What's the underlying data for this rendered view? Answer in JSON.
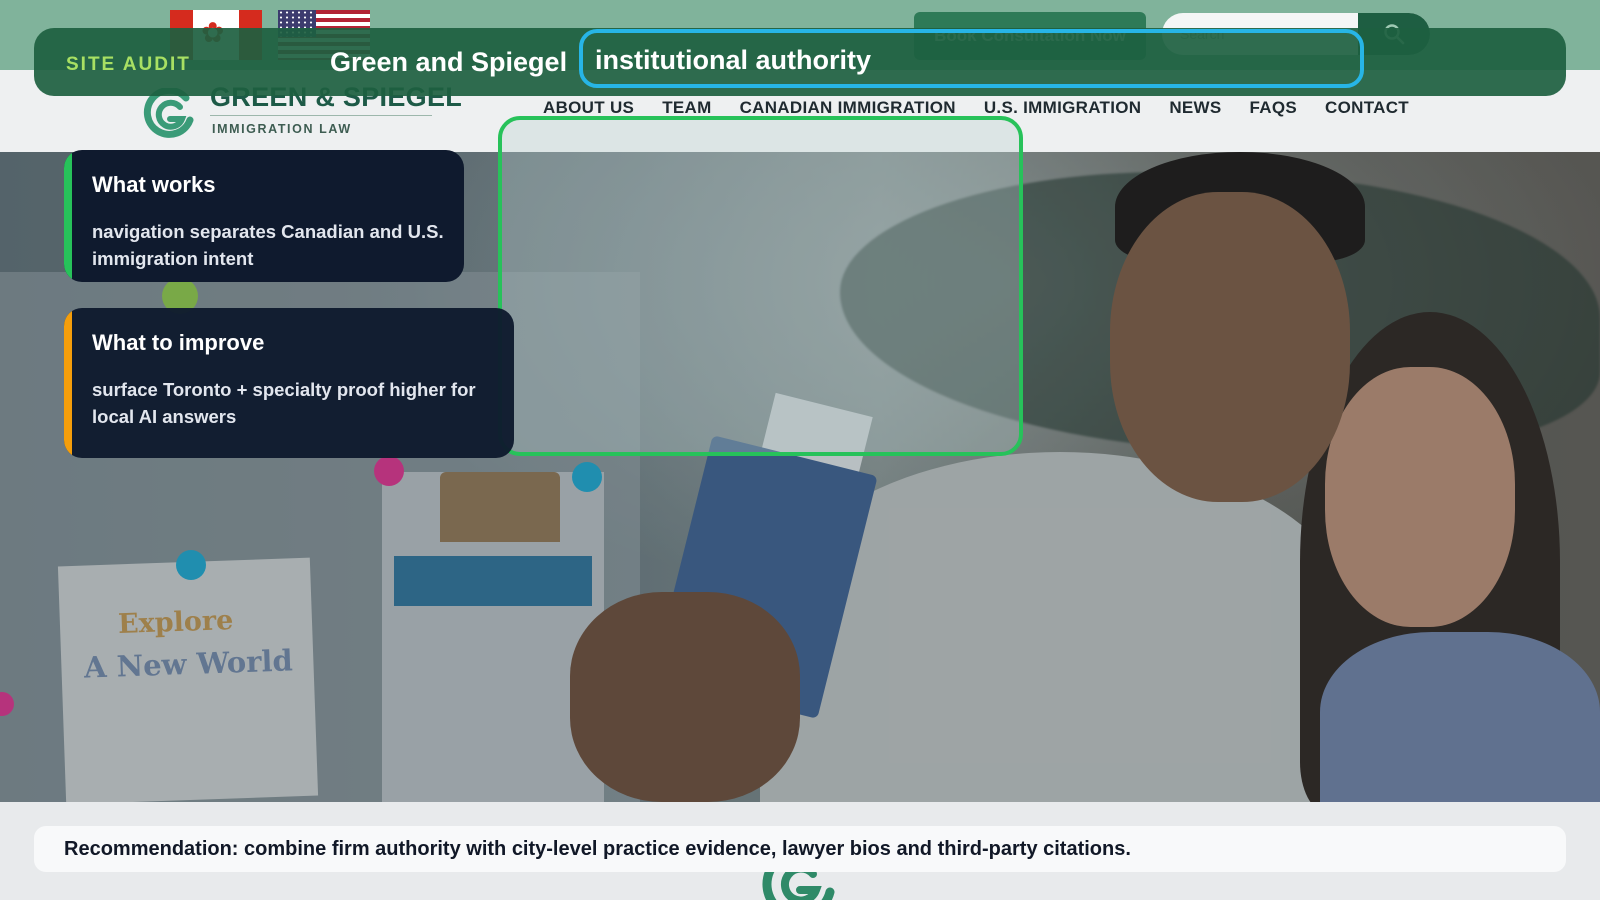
{
  "topbar": {
    "book_button": "Book Consultation Now",
    "search_placeholder": "Search"
  },
  "logo": {
    "name": "GREEN & SPIEGEL",
    "tagline": "IMMIGRATION LAW"
  },
  "nav": {
    "items": [
      "ABOUT US",
      "TEAM",
      "CANADIAN IMMIGRATION",
      "U.S. IMMIGRATION",
      "NEWS",
      "FAQS",
      "CONTACT"
    ]
  },
  "hero": {
    "poster_line1": "Explore",
    "poster_line2": "A New World"
  },
  "audit": {
    "tag": "SITE AUDIT",
    "site_name": "Green and Spiegel",
    "theme": "institutional authority",
    "colors": {
      "bar": "#1d5f40",
      "tag": "#a8e063",
      "theme_outline": "#27b5e6",
      "focus_outline": "#27c25a",
      "improve_accent": "#f59e0b",
      "card_bg": "#0f1a2e"
    }
  },
  "cards": {
    "works": {
      "title": "What works",
      "body": "navigation separates Canadian and U.S. immigration intent"
    },
    "improve": {
      "title": "What to improve",
      "body": "surface Toronto + specialty proof higher for local AI answers"
    }
  },
  "recommendation": "Recommendation: combine firm authority with city-level practice evidence, lawyer bios and third-party citations."
}
